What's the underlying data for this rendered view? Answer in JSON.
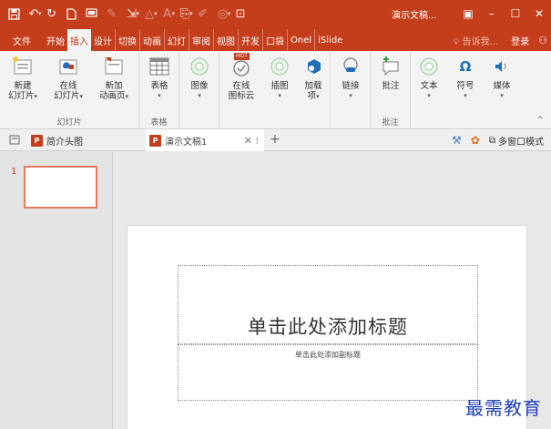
{
  "app": {
    "title": "演示文稿..."
  },
  "tabs": {
    "file": "文件",
    "items": [
      "开始",
      "插入",
      "设计",
      "切换",
      "动画",
      "幻灯",
      "审阅",
      "视图",
      "开发",
      "口袋",
      "Onel",
      "iSlide"
    ],
    "tell_me": "告诉我...",
    "login": "登录",
    "share_icon": "user-icon"
  },
  "ribbon": {
    "groups": {
      "slides": "幻灯片",
      "tables": "表格",
      "comments": "批注"
    },
    "buttons": {
      "new_slide": [
        "新建",
        "幻灯片"
      ],
      "online_slide": [
        "在线",
        "幻灯片"
      ],
      "add_page": [
        "新加",
        "动画页"
      ],
      "table": "表格",
      "image": "图像",
      "online_icon": [
        "在线",
        "图标云"
      ],
      "illustrations": "插图",
      "addins": [
        "加载",
        "项"
      ],
      "link": "链接",
      "comment": "批注",
      "text": "文本",
      "symbol": "符号",
      "media": "媒体"
    },
    "hot_badge": "HOT"
  },
  "docbar": {
    "tab1": "简介头图",
    "tab2": "演示文稿1",
    "multi_window": "多窗口模式"
  },
  "slides": {
    "thumb_number": "1"
  },
  "slide": {
    "title_placeholder": "单击此处添加标题",
    "subtitle_placeholder": "单击此处添加副标题"
  },
  "watermark": "最需教育",
  "colors": {
    "accent": "#c43e1c",
    "thumb_border": "#e27b5c",
    "watermark": "#1f3fb8"
  }
}
